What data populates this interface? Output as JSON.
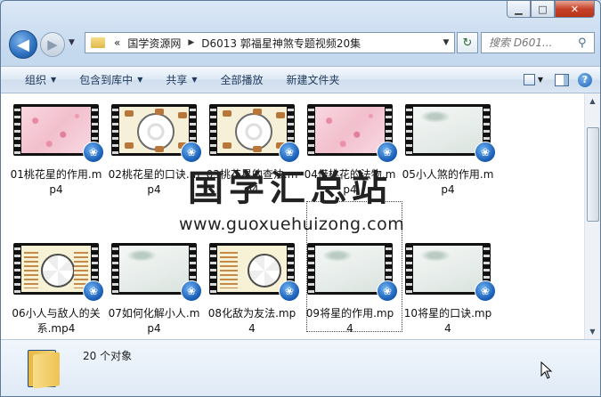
{
  "window": {
    "caption": {
      "minimize": "▁",
      "maximize": "□",
      "close": "✕"
    }
  },
  "nav": {
    "back_icon": "arrow-left-icon",
    "forward_icon": "arrow-right-icon",
    "breadcrumb": {
      "overflow": "«",
      "root": "国学资源网",
      "folder": "D6013 郭福星神煞专题视频20集"
    },
    "search_placeholder": "搜索 D601...",
    "search_icon": "magnifier-icon"
  },
  "toolbar": {
    "organize": "组织",
    "include_library": "包含到库中",
    "share": "共享",
    "play_all": "全部播放",
    "new_folder": "新建文件夹"
  },
  "files": [
    {
      "name": "01桃花星的作用.mp4",
      "thumb": "pink"
    },
    {
      "name": "02桃花星的口诀.mp4",
      "thumb": "wheel"
    },
    {
      "name": "03桃花星的查法.mp4",
      "thumb": "wheel"
    },
    {
      "name": "04借桃花的法物.mp4",
      "thumb": "pink"
    },
    {
      "name": "05小人煞的作用.mp4",
      "thumb": "ink"
    },
    {
      "name": "06小人与敌人的关系.mp4",
      "thumb": "chart"
    },
    {
      "name": "07如何化解小人.mp4",
      "thumb": "ink"
    },
    {
      "name": "08化敌为友法.mp4",
      "thumb": "chartl"
    },
    {
      "name": "09将星的作用.mp4",
      "thumb": "ink"
    },
    {
      "name": "10将星的口诀.mp4",
      "thumb": "ink"
    }
  ],
  "watermark": {
    "title": "国学汇总站",
    "url": "www.guoxuehuizong.com"
  },
  "details": {
    "count": "20 个对象"
  },
  "colors": {
    "toolbar_text": "#1e395b",
    "badge": "#1a5fb8",
    "close_button": "#c7432a"
  }
}
